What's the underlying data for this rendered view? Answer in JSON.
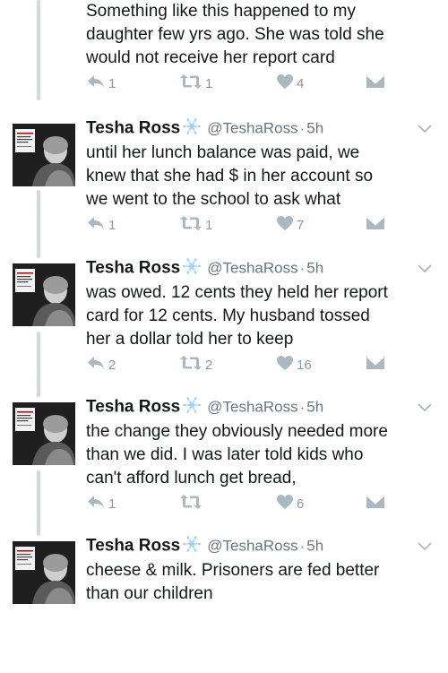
{
  "author": {
    "name": "Tesha Ross",
    "handle": "@TeshaRoss",
    "time": "5h"
  },
  "tweets": [
    {
      "show_header": false,
      "text_lines": [
        "Something like this happened to my",
        "daughter few yrs ago. She was told she",
        "would not receive her report card"
      ],
      "reply_count": "1",
      "retweet_count": "1",
      "like_count": "4"
    },
    {
      "show_header": true,
      "text_lines": [
        "until her lunch balance was paid, we",
        "knew that she had $ in her account so",
        "we went to the school to ask what"
      ],
      "reply_count": "1",
      "retweet_count": "1",
      "like_count": "7"
    },
    {
      "show_header": true,
      "text_lines": [
        "was owed. 12 cents they held her report",
        "card for 12 cents. My husband tossed",
        "her a dollar told her to keep"
      ],
      "reply_count": "2",
      "retweet_count": "2",
      "like_count": "16"
    },
    {
      "show_header": true,
      "text_lines": [
        "the change they obviously needed more",
        "than we did. I was later told kids who",
        "can't afford lunch get bread,"
      ],
      "reply_count": "1",
      "retweet_count": "",
      "like_count": "6"
    },
    {
      "show_header": true,
      "text_lines": [
        "cheese & milk. Prisoners are fed better",
        "than our children"
      ],
      "reply_count": "",
      "retweet_count": "",
      "like_count": ""
    }
  ],
  "icons": {
    "reply": "reply-icon",
    "retweet": "retweet-icon",
    "like": "heart-icon",
    "dm": "direct-message-icon",
    "more": "chevron-down-icon",
    "badge": "snowflake-badge-icon"
  },
  "colors": {
    "icon_gray": "#aab8c2",
    "muted_text": "#657786",
    "thread_line": "#cfd9de",
    "badge_blue": "#9fd3f5"
  }
}
